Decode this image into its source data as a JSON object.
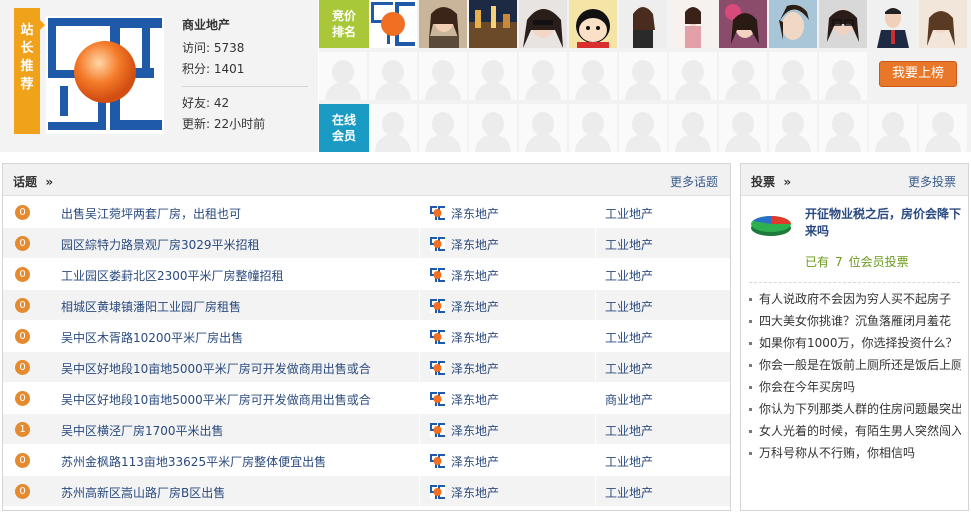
{
  "profile": {
    "tag": [
      "站",
      "长",
      "推",
      "荐"
    ],
    "name": "商业地产",
    "visits_label": "访问: ",
    "visits": "5738",
    "points_label": "积分: ",
    "points": "1401",
    "friends_label": "好友: ",
    "friends": "42",
    "updated_label": "更新: ",
    "updated": "22小时前"
  },
  "rank": {
    "label_line1": "竞价",
    "label_line2": "排名",
    "button": "我要上榜"
  },
  "online": {
    "label_line1": "在线",
    "label_line2": "会员"
  },
  "topics": {
    "title": "话题",
    "arrow": "»",
    "more": "更多话题",
    "rows": [
      {
        "count": "0",
        "title": "出售吴江菀坪两套厂房，出租也可",
        "author": "泽东地产",
        "category": "工业地产"
      },
      {
        "count": "0",
        "title": "园区綜特力路景观厂房3029平米招租",
        "author": "泽东地产",
        "category": "工业地产"
      },
      {
        "count": "0",
        "title": "工业园区娄葑北区2300平米厂房整幢招租",
        "author": "泽东地产",
        "category": "工业地产"
      },
      {
        "count": "0",
        "title": "相城区黄埭镇潘阳工业园厂房租售",
        "author": "泽东地产",
        "category": "工业地产"
      },
      {
        "count": "0",
        "title": "吴中区木胥路10200平米厂房出售",
        "author": "泽东地产",
        "category": "工业地产"
      },
      {
        "count": "0",
        "title": "吴中区好地段10亩地5000平米厂房可开发做商用出售或合",
        "author": "泽东地产",
        "category": "工业地产"
      },
      {
        "count": "0",
        "title": "吴中区好地段10亩地5000平米厂房可开发做商用出售或合",
        "author": "泽东地产",
        "category": "商业地产"
      },
      {
        "count": "1",
        "title": "吴中区横泾厂房1700平米出售",
        "author": "泽东地产",
        "category": "工业地产"
      },
      {
        "count": "0",
        "title": "苏州金枫路113亩地33625平米厂房整体便宜出售",
        "author": "泽东地产",
        "category": "工业地产"
      },
      {
        "count": "0",
        "title": "苏州高新区嵩山路厂房B区出售",
        "author": "泽东地产",
        "category": "工业地产"
      }
    ]
  },
  "votes": {
    "title": "投票",
    "arrow": "»",
    "more": "更多投票",
    "feature_title": "开征物业税之后，房价会降下来吗",
    "count_prefix": "已有",
    "count": "7",
    "count_suffix": "位会员投票",
    "items": [
      "有人说政府不会因为穷人买不起房子",
      "四大美女你挑谁？沉鱼落雁闭月羞花",
      "如果你有1000万，你选择投资什么？",
      "你会一般是在饭前上厕所还是饭后上厕所",
      "你会在今年买房吗",
      "你认为下列那类人群的住房问题最突出",
      "女人光着的时候，有陌生男人突然闯入",
      "万科号称从不行贿，你相信吗"
    ]
  },
  "colors": {
    "tag_orange": "#f0a21b",
    "rank_green": "#a8c83a",
    "online_blue": "#1a9bc3",
    "button_orange": "#e8772a",
    "badge_orange": "#e58a2e",
    "link_blue": "#2a4a7f"
  }
}
